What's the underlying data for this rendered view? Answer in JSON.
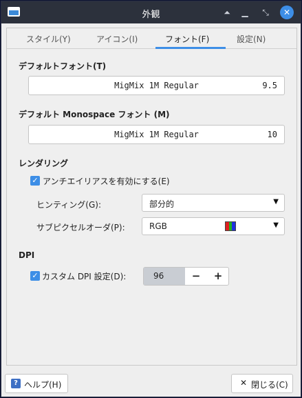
{
  "window": {
    "title": "外観"
  },
  "tabs": [
    {
      "label": "スタイル(Y)"
    },
    {
      "label": "アイコン(I)"
    },
    {
      "label": "フォント(F)",
      "active": true
    },
    {
      "label": "設定(N)"
    }
  ],
  "default_font": {
    "heading": "デフォルトフォント(T)",
    "name": "MigMix 1M Regular",
    "size": "9.5"
  },
  "mono_font": {
    "heading": "デフォルト Monospace フォント (M)",
    "name": "MigMix 1M Regular",
    "size": "10"
  },
  "rendering": {
    "heading": "レンダリング",
    "antialias_label": "アンチエイリアスを有効にする(E)",
    "antialias_checked": true,
    "hinting_label": "ヒンティング(G):",
    "hinting_value": "部分的",
    "subpixel_label": "サブピクセルオーダ(P):",
    "subpixel_value": "RGB"
  },
  "dpi": {
    "heading": "DPI",
    "custom_label": "カスタム DPI 設定(D):",
    "custom_checked": true,
    "value": "96"
  },
  "buttons": {
    "help": "ヘルプ(H)",
    "close": "閉じる(C)"
  },
  "colors": {
    "accent": "#3d8ee6",
    "titlebar": "#2c313c"
  }
}
